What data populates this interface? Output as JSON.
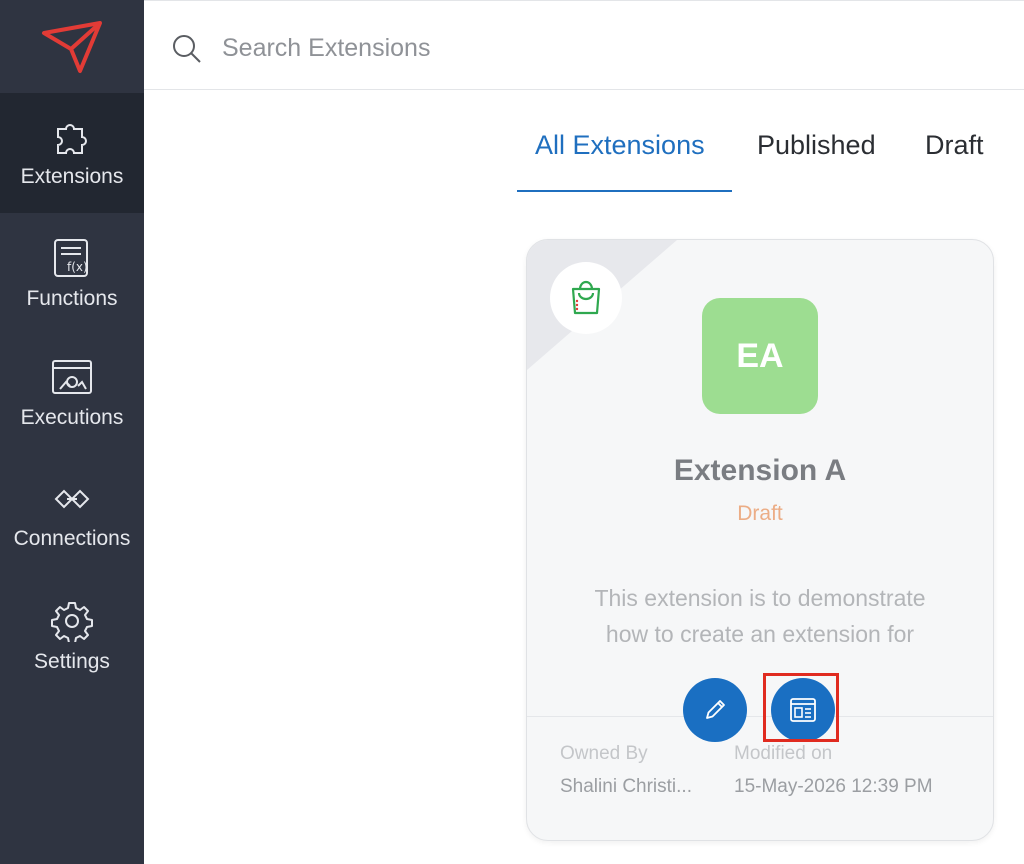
{
  "sidebar": {
    "items": [
      {
        "label": "Extensions",
        "icon": "puzzle-icon",
        "active": true
      },
      {
        "label": "Functions",
        "icon": "function-icon",
        "active": false
      },
      {
        "label": "Executions",
        "icon": "executions-icon",
        "active": false
      },
      {
        "label": "Connections",
        "icon": "connections-icon",
        "active": false
      },
      {
        "label": "Settings",
        "icon": "gear-icon",
        "active": false
      }
    ]
  },
  "search": {
    "placeholder": "Search Extensions",
    "value": ""
  },
  "tabs": [
    {
      "label": "All Extensions",
      "active": true
    },
    {
      "label": "Published",
      "active": false
    },
    {
      "label": "Draft",
      "active": false
    }
  ],
  "card": {
    "initials": "EA",
    "name": "Extension A",
    "status": "Draft",
    "description_line1": "This extension is to demonstrate",
    "description_line2": "how to create an extension for",
    "owned_by_label": "Owned By",
    "owned_by_value": "Shalini Christi...",
    "modified_label": "Modified on",
    "modified_value": "15-May-2026 12:39 PM"
  },
  "colors": {
    "sidebar_bg": "#2f3441",
    "accent": "#1f6fbf",
    "avatar_bg": "#9ddd91",
    "draft_status": "#ecad86",
    "highlight": "#e02b20"
  }
}
